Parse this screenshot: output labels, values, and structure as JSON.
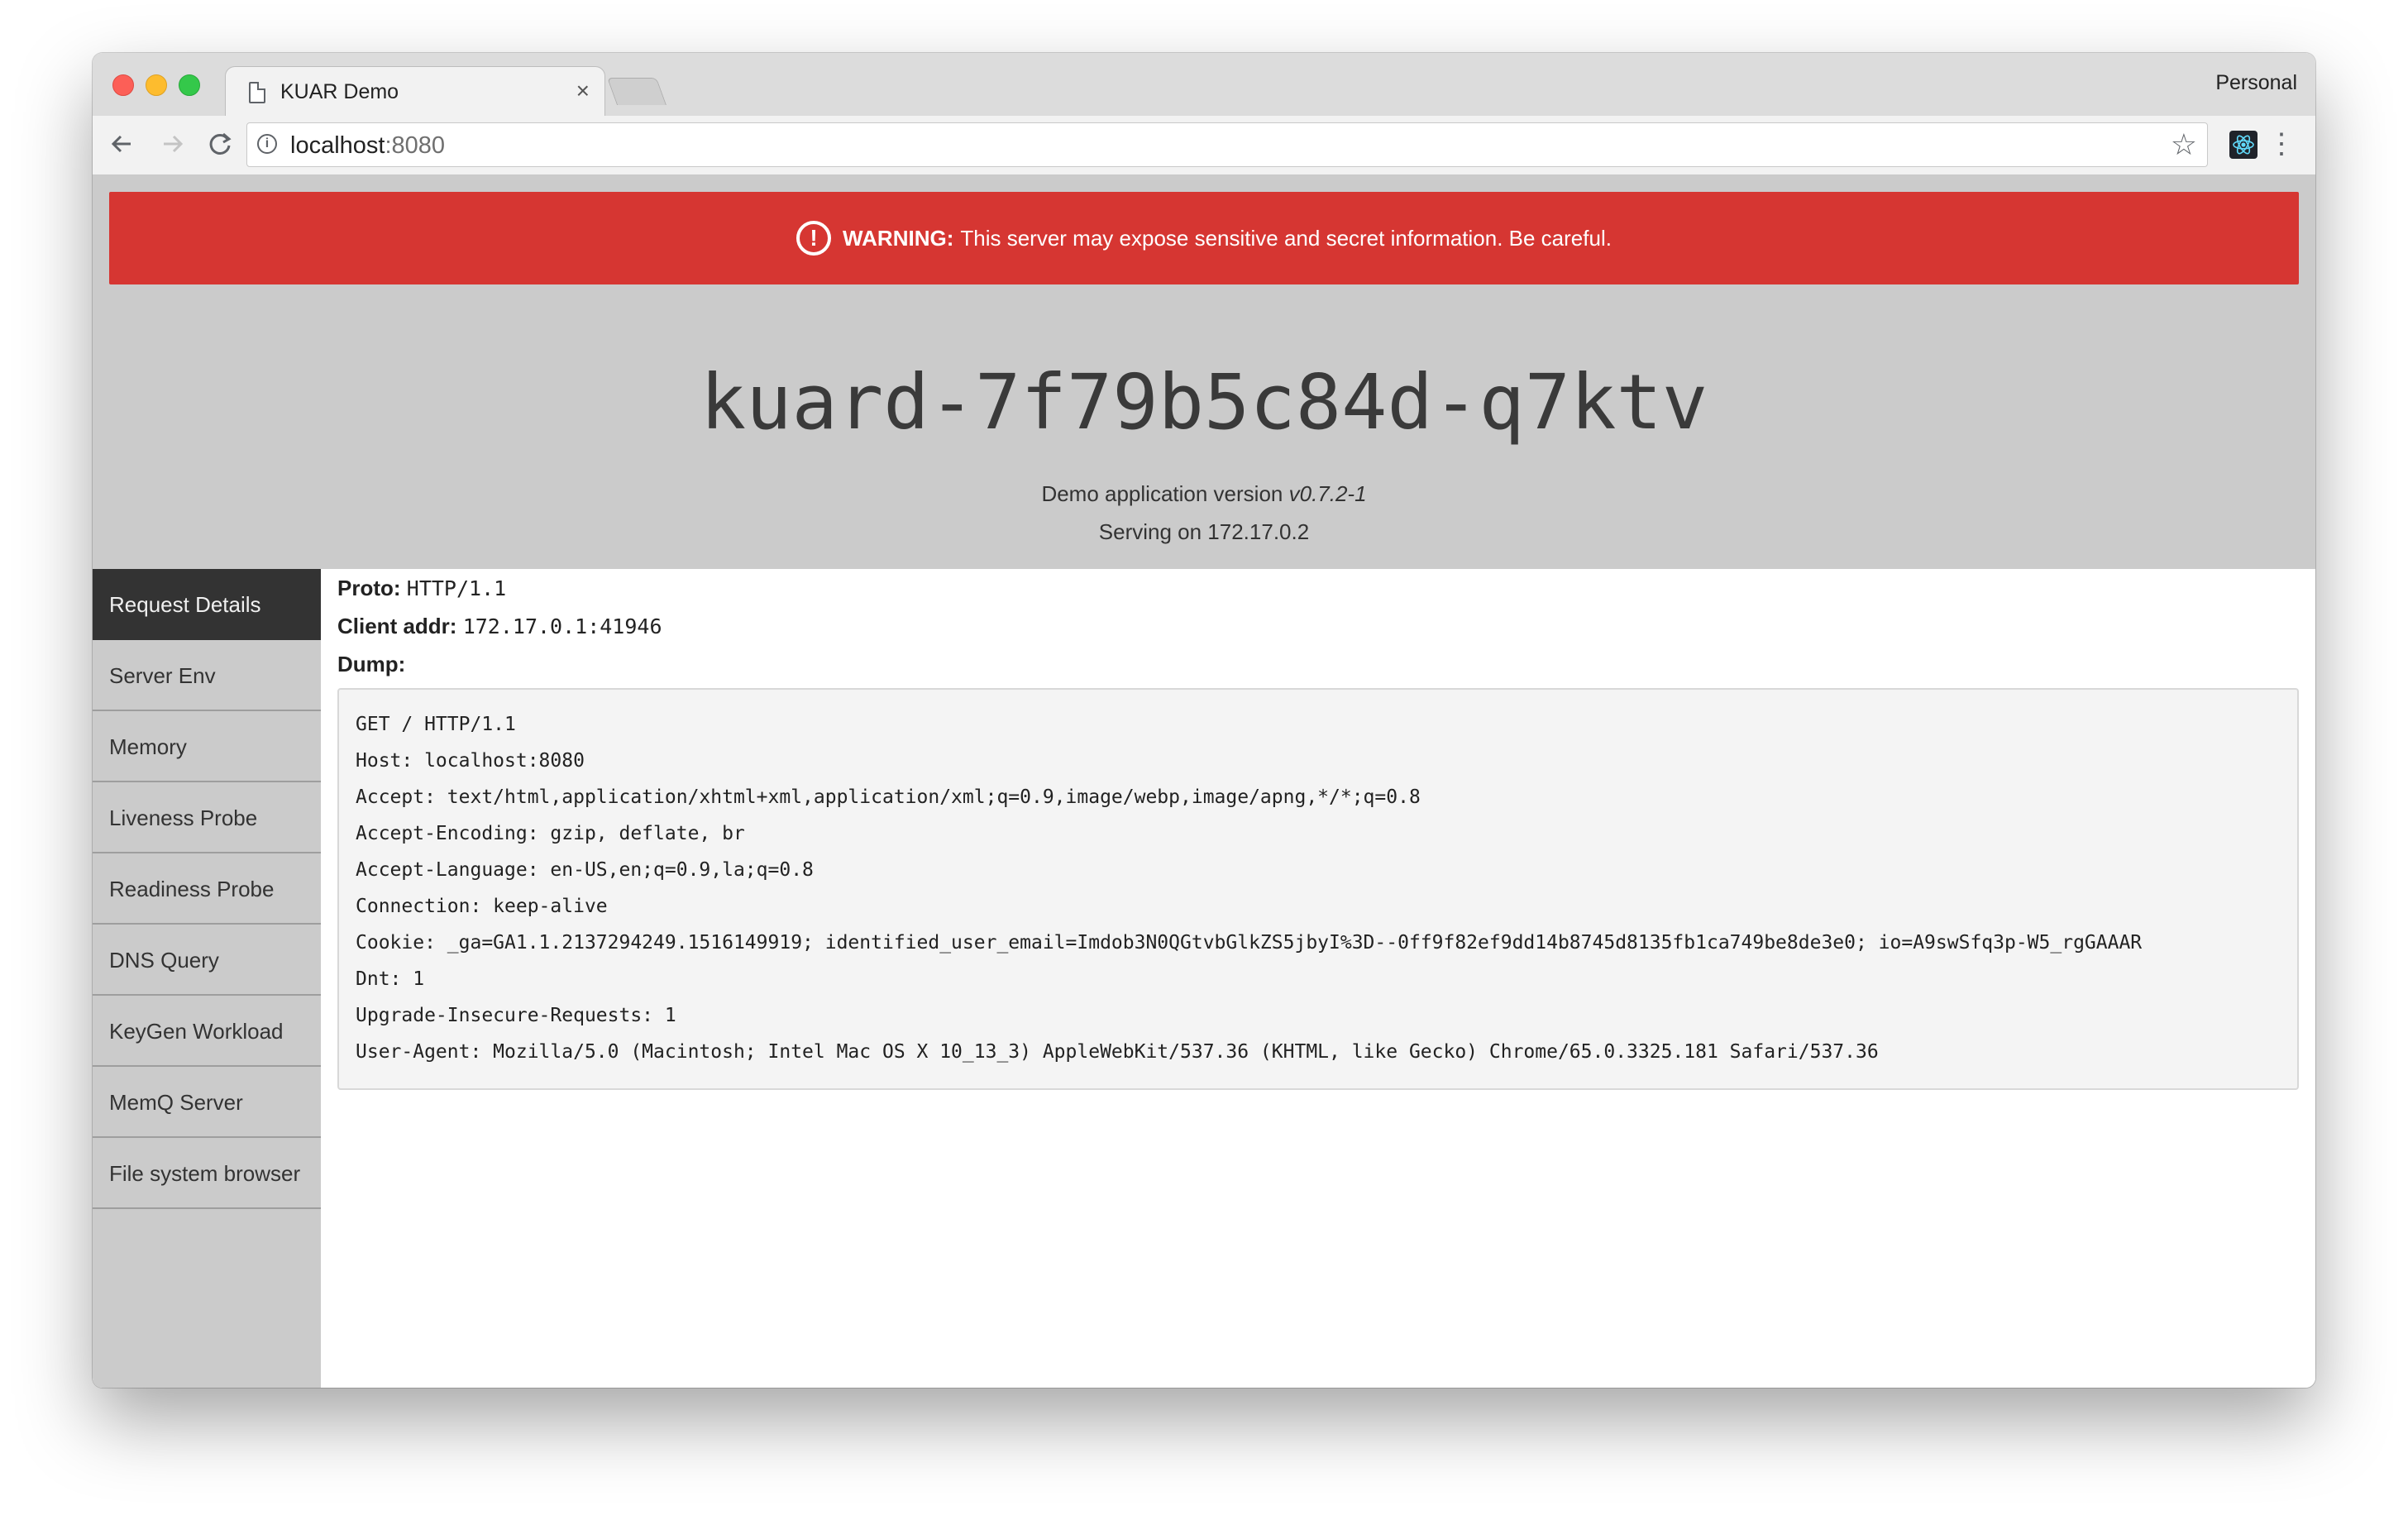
{
  "browser": {
    "tab_title": "KUAR Demo",
    "profile": "Personal",
    "url_host": "localhost",
    "url_port": ":8080",
    "tab_close_glyph": "×",
    "icons": [
      "page-icon",
      "back-icon",
      "forward-icon",
      "reload-icon",
      "info-icon",
      "star-icon",
      "react-devtools-icon",
      "menu-icon"
    ]
  },
  "warning": {
    "label": "WARNING:",
    "text": "This server may expose sensitive and secret information. Be careful.",
    "icon": "!",
    "color": "#d63632"
  },
  "header": {
    "hostname": "kuard-7f79b5c84d-q7ktv",
    "version_prefix": "Demo application version",
    "version": "v0.7.2-1",
    "serving": "Serving on 172.17.0.2"
  },
  "sidebar": {
    "items": [
      {
        "label": "Request Details",
        "active": true
      },
      {
        "label": "Server Env"
      },
      {
        "label": "Memory"
      },
      {
        "label": "Liveness Probe"
      },
      {
        "label": "Readiness Probe"
      },
      {
        "label": "DNS Query"
      },
      {
        "label": "KeyGen Workload"
      },
      {
        "label": "MemQ Server"
      },
      {
        "label": "File system browser"
      }
    ]
  },
  "request": {
    "proto_label": "Proto:",
    "proto": "HTTP/1.1",
    "client_label": "Client addr:",
    "client": "172.17.0.1:41946",
    "dump_label": "Dump:",
    "dump": [
      "GET / HTTP/1.1",
      "Host: localhost:8080",
      "Accept: text/html,application/xhtml+xml,application/xml;q=0.9,image/webp,image/apng,*/*;q=0.8",
      "Accept-Encoding: gzip, deflate, br",
      "Accept-Language: en-US,en;q=0.9,la;q=0.8",
      "Connection: keep-alive",
      "Cookie: _ga=GA1.1.2137294249.1516149919; identified_user_email=Imdob3N0QGtvbGlkZS5jbyI%3D--0ff9f82ef9dd14b8745d8135fb1ca749be8de3e0; io=A9swSfq3p-W5_rgGAAAR",
      "Dnt: 1",
      "Upgrade-Insecure-Requests: 1",
      "User-Agent: Mozilla/5.0 (Macintosh; Intel Mac OS X 10_13_3) AppleWebKit/537.36 (KHTML, like Gecko) Chrome/65.0.3325.181 Safari/537.36"
    ]
  }
}
